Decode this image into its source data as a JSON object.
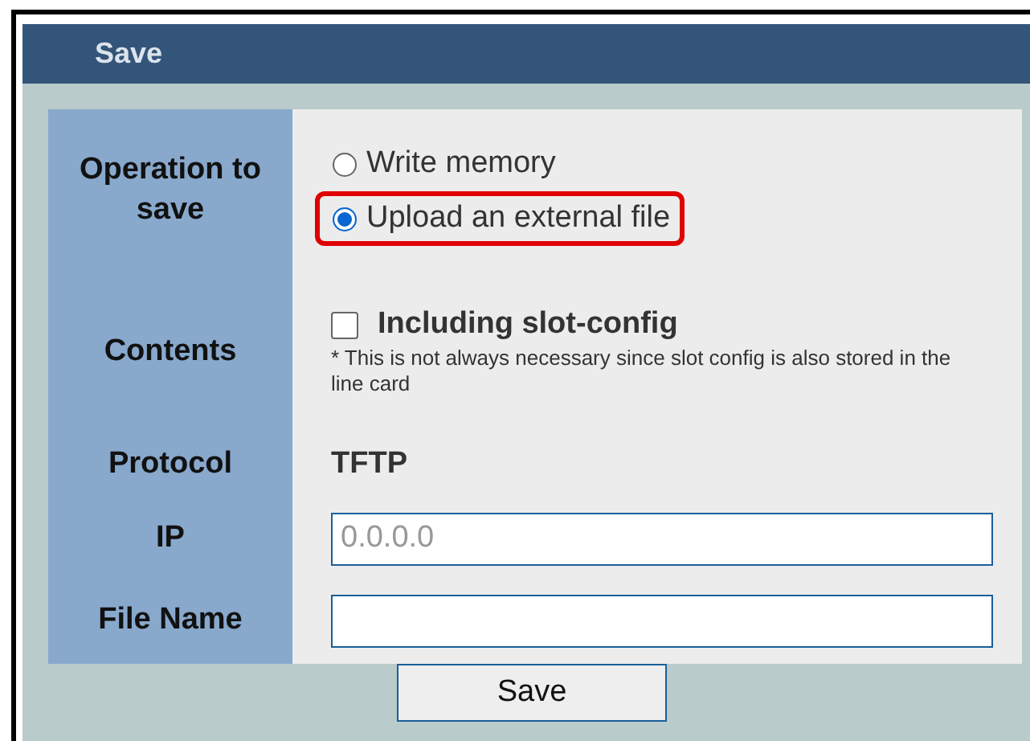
{
  "panel": {
    "title": "Save"
  },
  "rows": [
    {
      "kind": "radios",
      "label": "Operation to save",
      "options": [
        {
          "label": "Write memory",
          "selected": false,
          "highlighted": false
        },
        {
          "label": "Upload an external file",
          "selected": true,
          "highlighted": true
        }
      ]
    },
    {
      "kind": "checkbox",
      "label": "Contents",
      "checkbox": {
        "label": "Including slot-config",
        "checked": false
      },
      "note": "* This is not always necessary since slot config is also stored in the line card"
    },
    {
      "kind": "text",
      "label": "Protocol",
      "value": "TFTP"
    },
    {
      "kind": "input",
      "label": "IP",
      "placeholder": "0.0.0.0"
    },
    {
      "kind": "input",
      "label": "File Name"
    }
  ],
  "button": "Save"
}
